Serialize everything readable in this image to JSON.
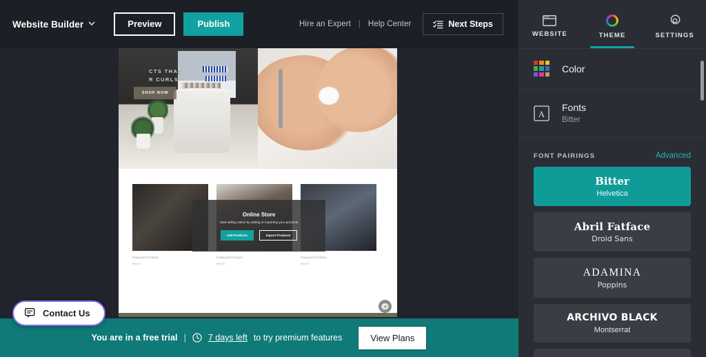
{
  "topbar": {
    "brand": "Website Builder",
    "brand_caret_icon": "chevron-down-icon",
    "preview_label": "Preview",
    "publish_label": "Publish",
    "hire_expert_label": "Hire an Expert",
    "separator": "|",
    "help_center_label": "Help Center",
    "next_steps_label": "Next Steps",
    "next_steps_icon": "checklist-icon"
  },
  "canvas": {
    "hero": {
      "headline_line1": "CTS THAT",
      "headline_line2": "R CURLS",
      "shop_now_label": "SHOP NOW"
    },
    "products": [
      {
        "name": "Featured Product",
        "price": "$00.00"
      },
      {
        "name": "Featured Product",
        "price": "$00.00"
      },
      {
        "name": "Featured Product",
        "price": "$00.00"
      }
    ],
    "store_overlay": {
      "title": "Online Store",
      "subtitle": "Start selling online by adding or importing your products",
      "add_products_label": "Add Products",
      "import_products_label": "Import Products"
    },
    "chat_widget_icon": "chat-bubble-icon"
  },
  "contact": {
    "label": "Contact Us",
    "icon": "chat-icon",
    "border_color": "#8a6cf0"
  },
  "trial": {
    "message": "You are in a free trial",
    "separator": "|",
    "clock_icon": "clock-icon",
    "days_left": "7 days left",
    "suffix": "to try premium features",
    "view_plans_label": "View Plans",
    "background_color": "#0f7a78"
  },
  "sidebar": {
    "tabs": [
      {
        "label": "WEBSITE",
        "icon": "browser-window-icon",
        "active": false
      },
      {
        "label": "THEME",
        "icon": "color-wheel-icon",
        "active": true
      },
      {
        "label": "SETTINGS",
        "icon": "gear-icon",
        "active": false
      }
    ],
    "color_row": {
      "title": "Color",
      "icon": "color-swatch-grid-icon",
      "swatches": [
        "#d9342b",
        "#f08a1e",
        "#f2c70d",
        "#3fae49",
        "#17a2a2",
        "#2b6fd4",
        "#8a4fd8",
        "#e0379a",
        "#c79b6a"
      ]
    },
    "fonts_row": {
      "title": "Fonts",
      "subtitle": "Bitter",
      "icon": "font-box-icon"
    },
    "font_pairings": {
      "section_label": "FONT PAIRINGS",
      "advanced_label": "Advanced",
      "accent_color": "#27b4ad",
      "items": [
        {
          "primary": "Bitter",
          "secondary": "Helvetica",
          "selected": true
        },
        {
          "primary": "Abril Fatface",
          "secondary": "Droid Sans",
          "selected": false
        },
        {
          "primary": "ADAMINA",
          "secondary": "Poppins",
          "selected": false
        },
        {
          "primary": "ARCHIVO BLACK",
          "secondary": "Montserrat",
          "selected": false
        }
      ]
    }
  }
}
